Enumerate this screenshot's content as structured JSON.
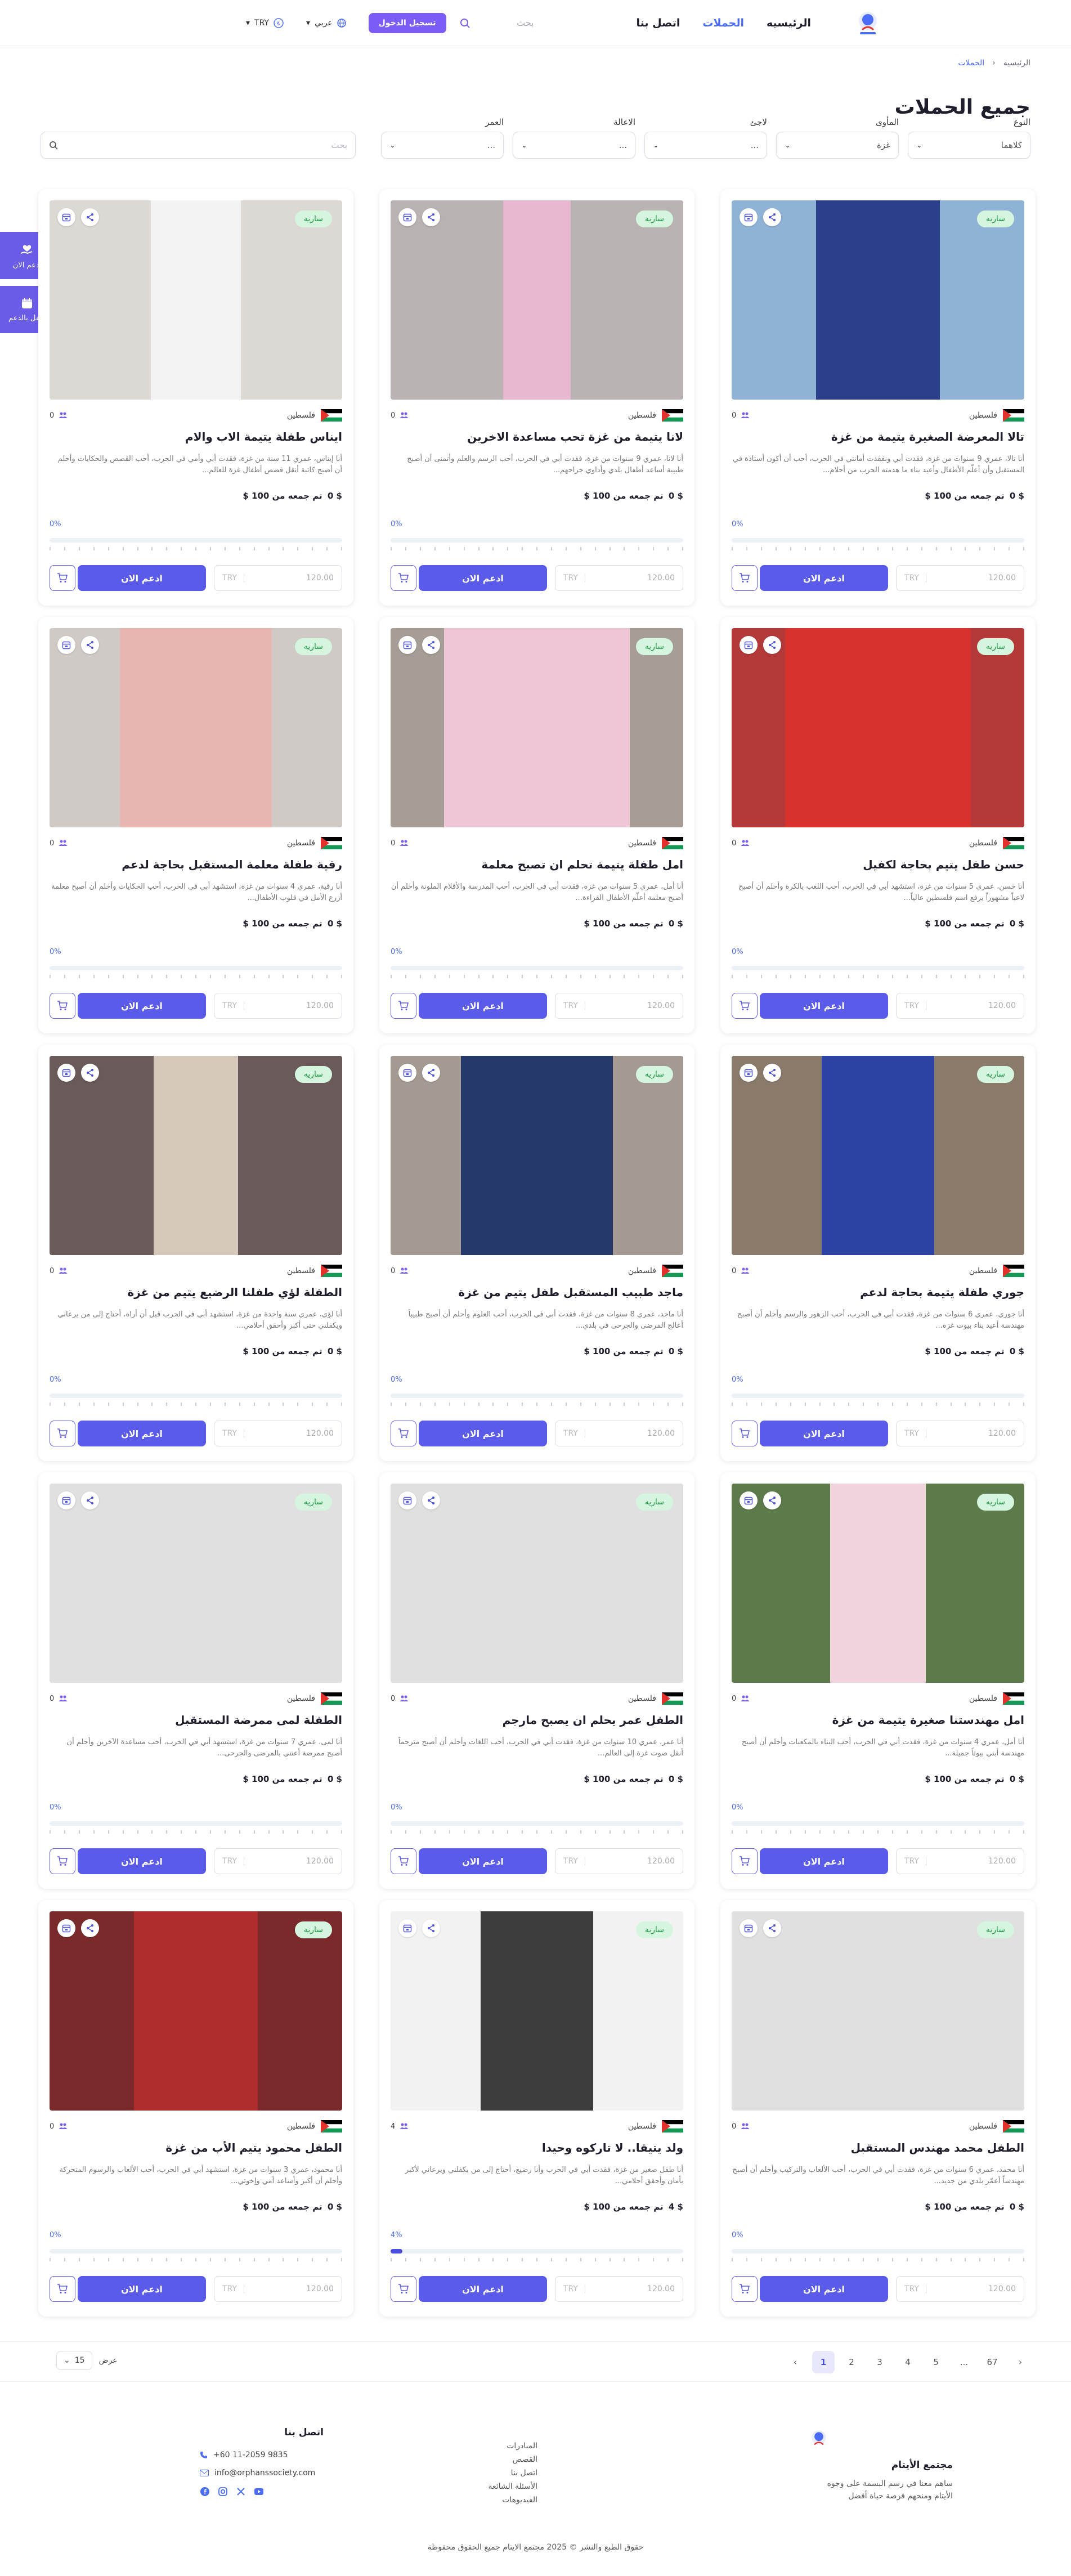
{
  "header": {
    "nav": [
      "الرئيسيه",
      "الحملات",
      "اتصل بنا"
    ],
    "search_placeholder": "بحث",
    "login": "تسجيل الدخول",
    "lang": "عربي",
    "currency": "TRY"
  },
  "breadcrumb": {
    "home": "الرئيسيه",
    "current": "الحملات"
  },
  "page_title": "جميع الحملات",
  "filters": {
    "type_label": "النوع",
    "type_value": "كلاهما",
    "shelter_label": "المأوى",
    "shelter_value": "غزة",
    "refugee_label": "لاجئ",
    "care_label": "الاعالة",
    "age_label": "العمر",
    "search_placeholder": "بحث",
    "empty_option": "..."
  },
  "side": {
    "donate_now": "ادعم الان",
    "sponsor": "تكفل بالدعم"
  },
  "colors": {
    "accent": "#5b5bea",
    "brand": "#7b5cf5",
    "active": "#d6f5de"
  },
  "card_common": {
    "status": "ساريه",
    "country": "فلسطين",
    "raised_label": "تم جمعه من",
    "goal": "100 $",
    "amount": "120.00",
    "currency": "TRY",
    "button": "ادعم الان"
  },
  "cards": [
    {
      "title": "تالا المعرضة الصغيرة يتيمة من غزة",
      "desc": "أنا تالا، عمري 9 سنوات من غزة، فقدت أبي ونفقدت أمانتي في الحرب، أحب أن أكون أستاذة في المستقبل وأن أعلّم الأطفال وأعيد بناء ما هدمته الحرب من أحلام...",
      "raised": "$ 0",
      "percent": 0,
      "supporters": "0"
    },
    {
      "title": "لانا يتيمة من غزة تحب مساعدة الاخرين",
      "desc": "أنا لانا، عمري 9 سنوات من غزة، فقدت أبي في الحرب، أحب الرسم والعلم وأتمنى أن أصبح طبيبة أساعد أطفال بلدي وأداوي جراحهم...",
      "raised": "$ 0",
      "percent": 0,
      "supporters": "0"
    },
    {
      "title": "ايناس طفلة يتيمة الاب والام",
      "desc": "أنا إيناس، عمري 11 سنة من غزة، فقدت أبي وأمي في الحرب، أحب القصص والحكايات وأحلم أن أصبح كاتبة أنقل قصص أطفال غزة للعالم...",
      "raised": "$ 0",
      "percent": 0,
      "supporters": "0"
    },
    {
      "title": "حسن طفل يتيم بحاجة لكفيل",
      "desc": "أنا حسن، عمري 5 سنوات من غزة، استشهد أبي في الحرب، أحب اللعب بالكرة وأحلم أن أصبح لاعباً مشهوراً يرفع اسم فلسطين عالياً...",
      "raised": "$ 0",
      "percent": 0,
      "supporters": "0"
    },
    {
      "title": "امل طفلة يتيمة تحلم ان تصبح معلمة",
      "desc": "أنا أمل، عمري 5 سنوات من غزة، فقدت أبي في الحرب، أحب المدرسة والأقلام الملونة وأحلم أن أصبح معلمة أعلّم الأطفال القراءة...",
      "raised": "$ 0",
      "percent": 0,
      "supporters": "0"
    },
    {
      "title": "رقية طفلة معلمة المستقبل بحاجة لدعم",
      "desc": "أنا رقية، عمري 4 سنوات من غزة، استشهد أبي في الحرب، أحب الحكايات وأحلم أن أصبح معلمة أزرع الأمل في قلوب الأطفال...",
      "raised": "$ 0",
      "percent": 0,
      "supporters": "0"
    },
    {
      "title": "جوري طفلة يتيمة بحاجة لدعم",
      "desc": "أنا جوري، عمري 6 سنوات من غزة، فقدت أبي في الحرب، أحب الزهور والرسم وأحلم أن أصبح مهندسة أعيد بناء بيوت غزة...",
      "raised": "$ 0",
      "percent": 0,
      "supporters": "0"
    },
    {
      "title": "ماجد طبيب المستقبل طفل يتيم من غزة",
      "desc": "أنا ماجد، عمري 8 سنوات من غزة، فقدت أبي في الحرب، أحب العلوم وأحلم أن أصبح طبيباً أعالج المرضى والجرحى في بلدي...",
      "raised": "$ 0",
      "percent": 0,
      "supporters": "0"
    },
    {
      "title": "الطفلة لؤي طفلنا الرضيع يتيم من غزة",
      "desc": "أنا لؤي، عمري سنة واحدة من غزة، استشهد أبي في الحرب قبل أن أراه، أحتاج إلى من يرعاني ويكفلني حتى أكبر وأحقق أحلامي...",
      "raised": "$ 0",
      "percent": 0,
      "supporters": "0"
    },
    {
      "title": "امل مهندستنا صغيرة يتيمة من غزة",
      "desc": "أنا أمل، عمري 4 سنوات من غزة، فقدت أبي في الحرب، أحب البناء بالمكعبات وأحلم أن أصبح مهندسة أبني بيوتاً جميلة...",
      "raised": "$ 0",
      "percent": 0,
      "supporters": "0"
    },
    {
      "title": "الطفل عمر يحلم ان يصبح مارجم",
      "desc": "أنا عمر، عمري 10 سنوات من غزة، فقدت أبي في الحرب، أحب اللغات وأحلم أن أصبح مترجماً أنقل صوت غزة إلى العالم...",
      "raised": "$ 0",
      "percent": 0,
      "supporters": "0"
    },
    {
      "title": "الطفلة لمى ممرضة المستقبل",
      "desc": "أنا لمى، عمري 7 سنوات من غزة، استشهد أبي في الحرب، أحب مساعدة الآخرين وأحلم أن أصبح ممرضة أعتني بالمرضى والجرحى...",
      "raised": "$ 0",
      "percent": 0,
      "supporters": "0"
    },
    {
      "title": "الطفل محمد مهندس المستقبل",
      "desc": "أنا محمد، عمري 6 سنوات من غزة، فقدت أبي في الحرب، أحب الألعاب والتركيب وأحلم أن أصبح مهندساً أعمّر بلدي من جديد...",
      "raised": "$ 0",
      "percent": 0,
      "supporters": "0"
    },
    {
      "title": "ولد يتيقا.. لا تاركوه وحيدا",
      "desc": "أنا طفل صغير من غزة، فقدت أبي في الحرب وأنا رضيع، أحتاج إلى من يكفلني ويرعاني لأكبر بأمان وأحقق أحلامي...",
      "raised": "$ 4",
      "percent": 4,
      "supporters": "4"
    },
    {
      "title": "الطفل محمود يتيم الأب من غزة",
      "desc": "أنا محمود، عمري 3 سنوات من غزة، استشهد أبي في الحرب، أحب الألعاب والرسوم المتحركة وأحلم أن أكبر وأساعد أمي وإخوتي...",
      "raised": "$ 0",
      "percent": 0,
      "supporters": "0"
    }
  ],
  "pagination": {
    "pages": [
      "1",
      "2",
      "3",
      "4",
      "5",
      "...",
      "67"
    ],
    "current": "1",
    "per_page_label": "عرض",
    "per_page": "15"
  },
  "footer": {
    "brand_name": "مجتمع الأيتام",
    "tagline": "ساهم معنا في رسم البسمة على وجوه الأيتام ومنحهم فرصة حياة أفضل",
    "links": [
      "المبادرات",
      "القصص",
      "اتصل بنا",
      "الأسئلة الشائعة",
      "الفيديوهات"
    ],
    "contact_title": "اتصل بنا",
    "phone": "+60 11-2059 9835",
    "email": "info@orphanssociety.com",
    "copyright": "حقوق الطبع والنشر © 2025 مجتمع الايتام جميع الحقوق محفوظة"
  }
}
